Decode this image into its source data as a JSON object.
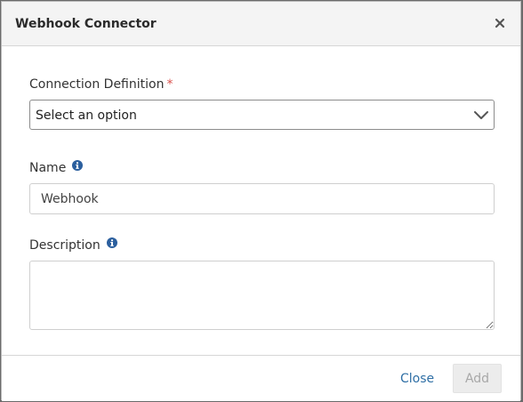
{
  "dialog": {
    "title": "Webhook Connector",
    "close_icon": "close-x-icon"
  },
  "form": {
    "connection_definition": {
      "label": "Connection Definition",
      "required_marker": "*",
      "selected_value": "Select an option",
      "icon": "chevron-down-icon"
    },
    "name": {
      "label": "Name",
      "value": "Webhook",
      "info_icon": "info-icon"
    },
    "description": {
      "label": "Description",
      "value": "",
      "info_icon": "info-icon"
    }
  },
  "footer": {
    "close_label": "Close",
    "add_label": "Add"
  },
  "colors": {
    "link": "#2f6fa5",
    "info_icon": "#2b5f9e",
    "required": "#d9534f",
    "disabled_button_bg": "#ececec"
  }
}
